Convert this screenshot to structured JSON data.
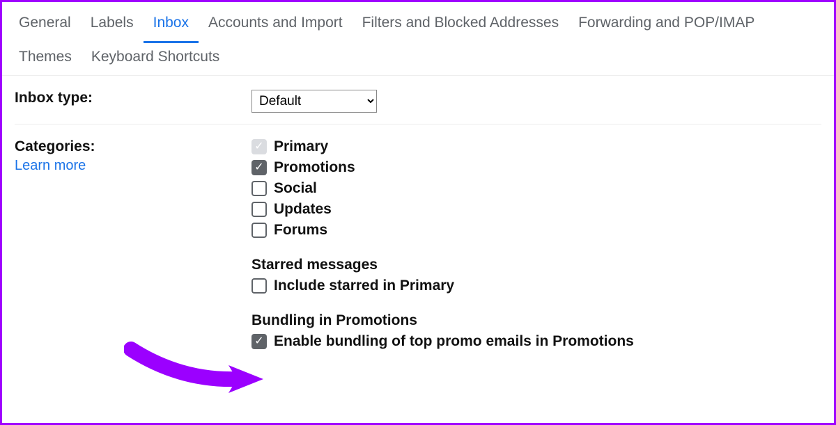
{
  "tabs": {
    "general": "General",
    "labels": "Labels",
    "inbox": "Inbox",
    "accounts": "Accounts and Import",
    "filters": "Filters and Blocked Addresses",
    "forwarding": "Forwarding and POP/IMAP",
    "themes": "Themes",
    "keyboard": "Keyboard Shortcuts"
  },
  "inbox_type": {
    "label": "Inbox type:",
    "value": "Default"
  },
  "categories": {
    "label": "Categories:",
    "learn_more": "Learn more",
    "items": {
      "primary": "Primary",
      "promotions": "Promotions",
      "social": "Social",
      "updates": "Updates",
      "forums": "Forums"
    }
  },
  "starred": {
    "heading": "Starred messages",
    "include": "Include starred in Primary"
  },
  "bundling": {
    "heading": "Bundling in Promotions",
    "enable": "Enable bundling of top promo emails in Promotions"
  }
}
